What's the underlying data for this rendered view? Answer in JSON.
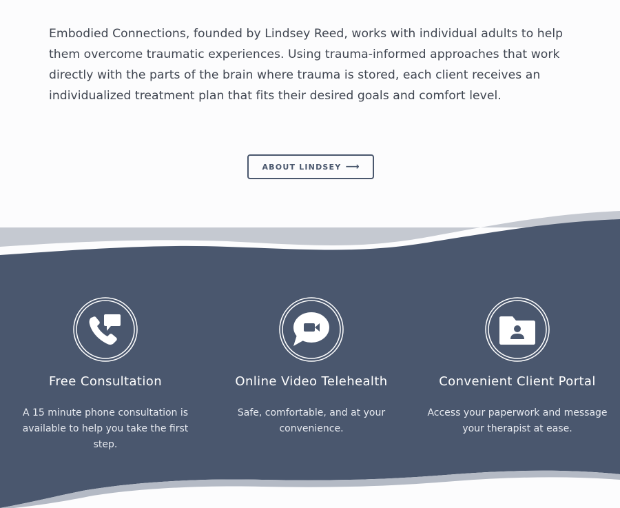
{
  "intro": {
    "text": "Embodied Connections, founded by Lindsey Reed, works with individual adults to help them overcome traumatic experiences.  Using trauma-informed approaches that work directly with the parts of the brain where trauma is stored, each client receives an individualized treatment plan that fits their desired goals and comfort level."
  },
  "about_button": {
    "label": "ABOUT LINDSEY",
    "arrow": "⟶"
  },
  "features": [
    {
      "icon": "phone-chat-icon",
      "title": "Free Consultation",
      "description": "A 15 minute phone consultation is available to help you take the first step."
    },
    {
      "icon": "video-chat-icon",
      "title": "Online Video Telehealth",
      "description": "Safe, comfortable, and at your convenience."
    },
    {
      "icon": "folder-user-icon",
      "title": "Convenient Client Portal",
      "description": "Access your paperwork and message your therapist at ease."
    }
  ],
  "colors": {
    "band": "#4a576e",
    "band_edge": "#c5c9d1",
    "text_dark": "#3f4550",
    "white": "#ffffff"
  }
}
